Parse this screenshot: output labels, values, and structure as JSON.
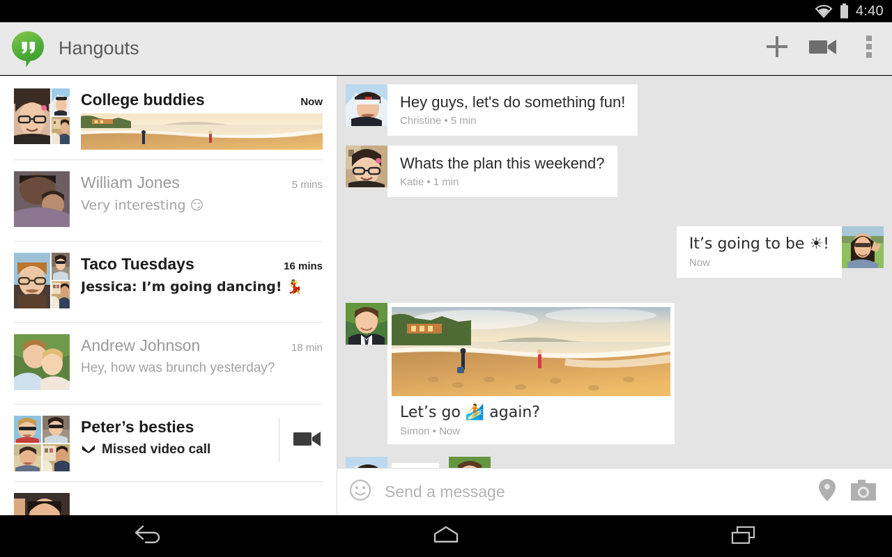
{
  "status_bar": {
    "wifi_icon": "wifi-icon",
    "battery_icon": "battery-icon",
    "clock": "4:40"
  },
  "action_bar": {
    "logo_icon": "hangouts-logo-icon",
    "title": "Hangouts",
    "new_hangout_label": "+",
    "new_hangout_icon": "plus-icon",
    "video_call_icon": "video-camera-icon",
    "overflow_icon": "overflow-menu-icon",
    "accent_color": "#5cb531",
    "bar_color": "#e9e9e9"
  },
  "conversations": [
    {
      "name": "College buddies",
      "time": "Now",
      "unread": true,
      "snippet": "",
      "has_thumbnail": true,
      "avatar_type": "mosaic-3",
      "avatar_alt": "group-photo-mosaic"
    },
    {
      "name": "William Jones",
      "time": "5 mins",
      "unread": false,
      "snippet": "Very interesting 😏",
      "has_thumbnail": false,
      "avatar_type": "mosaic-1",
      "avatar_alt": "man-with-child-photo"
    },
    {
      "name": "Taco Tuesdays",
      "time": "16 mins",
      "unread": true,
      "snippet": "Jessica: I’m going dancing! 💃",
      "has_thumbnail": false,
      "avatar_type": "mosaic-3",
      "avatar_alt": "group-photo-mosaic"
    },
    {
      "name": "Andrew Johnson",
      "time": "18 min",
      "unread": false,
      "snippet": "Hey, how was brunch yesterday?",
      "has_thumbnail": false,
      "avatar_type": "mosaic-1",
      "avatar_alt": "couple-in-grass-photo"
    },
    {
      "name": "Peter’s besties",
      "time": "",
      "unread": true,
      "snippet": "Missed video call",
      "missed_call": true,
      "missed_call_icon": "missed-call-arrow-icon",
      "action_icon": "video-camera-icon",
      "has_thumbnail": false,
      "avatar_type": "mosaic-4",
      "avatar_alt": "group-photo-mosaic"
    },
    {
      "name": "",
      "time": "",
      "unread": false,
      "snippet": "",
      "partial": true,
      "has_thumbnail": false,
      "avatar_type": "mosaic-1",
      "avatar_alt": "partial-avatar"
    }
  ],
  "chat": {
    "messages": [
      {
        "kind": "text",
        "direction": "incoming",
        "text": "Hey guys, let's do something fun!",
        "sender": "Christine",
        "time": "5 min",
        "meta": "Christine • 5 min",
        "avatar_alt": "christine-ski-photo"
      },
      {
        "kind": "text",
        "direction": "incoming",
        "text": "Whats the plan this weekend?",
        "sender": "Katie",
        "time": "1 min",
        "meta": "Katie • 1 min",
        "avatar_alt": "katie-glasses-photo"
      },
      {
        "kind": "text",
        "direction": "outgoing",
        "text": "It’s going to be ☀!",
        "sender": "",
        "time": "Now",
        "meta": "Now",
        "avatar_alt": "self-peace-sign-photo"
      },
      {
        "kind": "photo",
        "direction": "incoming",
        "text": "Let’s go 🏄 again?",
        "sender": "Simon",
        "time": "Now",
        "meta": "Simon • Now",
        "photo_alt": "beach-sunset-panorama",
        "avatar_alt": "simon-suit-photo"
      }
    ],
    "typing": {
      "indicator_dots": "• • •",
      "typing_avatar_alt": "christine-ski-photo",
      "watcher_avatar_alt": "simon-suit-photo"
    }
  },
  "compose": {
    "emoji_icon": "smiley-face-icon",
    "placeholder": "Send a message",
    "value": "",
    "location_icon": "location-pin-icon",
    "camera_icon": "camera-icon"
  },
  "nav_bar": {
    "back_icon": "back-arrow-icon",
    "home_icon": "home-icon",
    "recents_icon": "recent-apps-icon"
  }
}
